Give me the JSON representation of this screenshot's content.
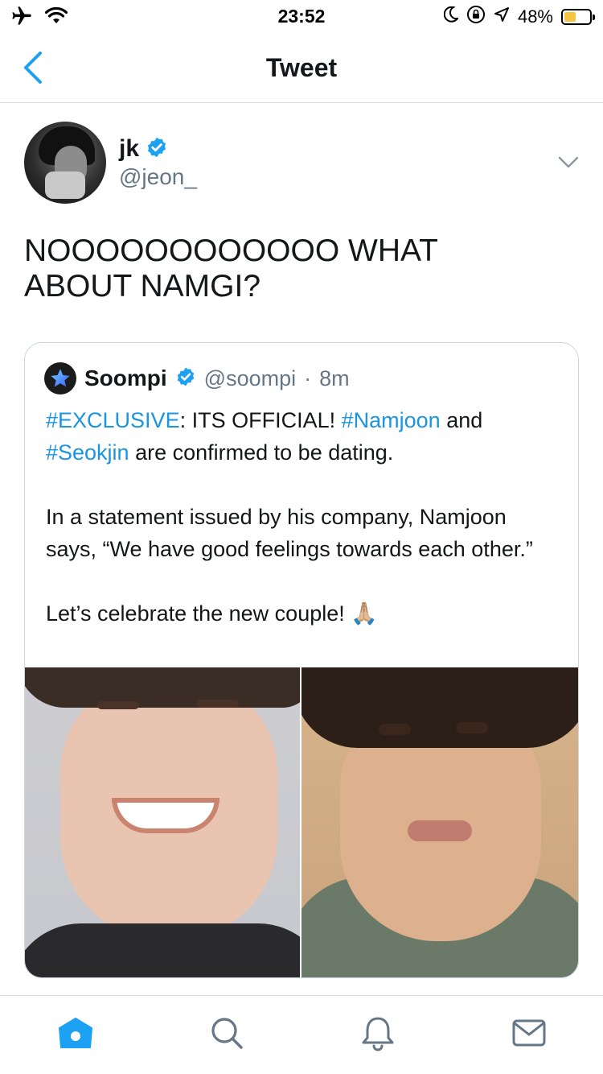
{
  "status_bar": {
    "time": "23:52",
    "battery_percent": "48%",
    "battery_level": 0.48,
    "icons": [
      "airplane-icon",
      "wifi-icon",
      "moon-icon",
      "orientation-lock-icon",
      "location-icon",
      "battery-icon"
    ]
  },
  "nav": {
    "title": "Tweet",
    "back_icon": "chevron-left-icon"
  },
  "tweet": {
    "author": {
      "name": "jk",
      "handle": "@jeon_",
      "verified": true
    },
    "text_line1": "NOOOOOOOOOOOO WHAT",
    "text_line2": "ABOUT NAMGI?"
  },
  "quote": {
    "author_name": "Soompi",
    "author_handle": "@soompi",
    "separator": "·",
    "time": "8m",
    "verified": true,
    "p1": {
      "tag1": "#EXCLUSIVE",
      "t1": ": ITS OFFICIAL! ",
      "tag2": "#Namjoon",
      "t2": " and ",
      "tag3": "#Seokjin",
      "t3": " are confirmed to be dating."
    },
    "p2": "In a statement issued by his company, Namjoon says, “We have good feelings towards each other.”",
    "p3_text": "Let’s celebrate the new couple! ",
    "p3_emoji": "🙏🏼"
  },
  "colors": {
    "accent": "#1da1f2",
    "hashtag": "#1b95e0",
    "secondary_text": "#657786",
    "divider": "#d8dde1"
  },
  "tab_bar": {
    "items": [
      "home-icon",
      "search-icon",
      "notifications-icon",
      "messages-icon"
    ],
    "active": "home-icon"
  }
}
